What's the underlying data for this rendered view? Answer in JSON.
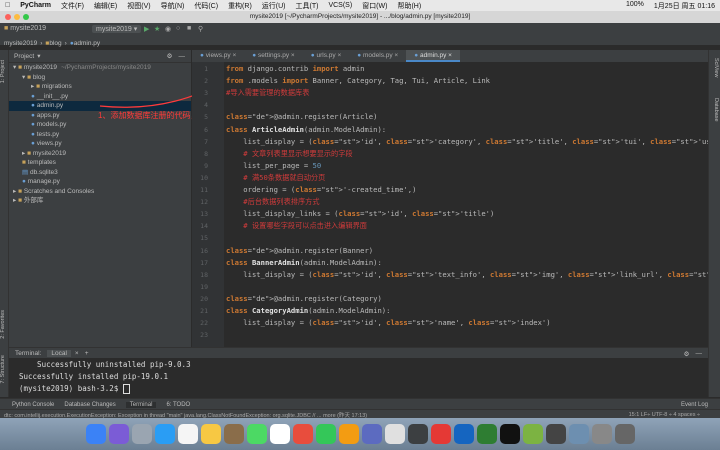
{
  "menubar": {
    "app": "PyCharm",
    "items": [
      "文件(F)",
      "编辑(E)",
      "视图(V)",
      "导航(N)",
      "代码(C)",
      "重构(R)",
      "运行(U)",
      "工具(T)",
      "VCS(S)",
      "窗口(W)",
      "帮助(H)"
    ],
    "battery": "100%",
    "clock": "1月25日 周五 01:16"
  },
  "titlebar": {
    "title": "mysite2019 [~/PycharmProjects/mysite2019] - .../blog/admin.py [mysite2019]"
  },
  "navbar": {
    "project": "mysite2019",
    "run_config": "mysite2019"
  },
  "breadcrumbs": [
    "mysite2019",
    "blog",
    "admin.py"
  ],
  "project_panel": {
    "title": "Project",
    "tree": [
      {
        "label": "mysite2019",
        "extra": "~/PycharmProjects/mysite2019",
        "type": "folder"
      },
      {
        "label": "blog",
        "type": "folder"
      },
      {
        "label": "migrations",
        "type": "folder"
      },
      {
        "label": "__init__.py",
        "type": "py"
      },
      {
        "label": "admin.py",
        "type": "py"
      },
      {
        "label": "apps.py",
        "type": "py"
      },
      {
        "label": "models.py",
        "type": "py"
      },
      {
        "label": "tests.py",
        "type": "py"
      },
      {
        "label": "views.py",
        "type": "py"
      },
      {
        "label": "mysite2019",
        "type": "folder"
      },
      {
        "label": "templates",
        "type": "folder"
      },
      {
        "label": "db.sqlite3",
        "type": "file"
      },
      {
        "label": "manage.py",
        "type": "py"
      },
      {
        "label": "Scratches and Consoles",
        "type": "folder"
      },
      {
        "label": "外部库",
        "type": "folder"
      }
    ]
  },
  "annotation": "1、添加数据库注册的代码，保存",
  "tabs": [
    "views.py",
    "settings.py",
    "urls.py",
    "models.py",
    "admin.py"
  ],
  "active_tab": "admin.py",
  "code_lines": [
    "from django.contrib import admin",
    "from .models import Banner, Category, Tag, Tui, Article, Link",
    "#导入需要管理的数据库表",
    "",
    "@admin.register(Article)",
    "class ArticleAdmin(admin.ModelAdmin):",
    "    list_display = ('id', 'category', 'title', 'tui', 'user', 'views', 'created_time')",
    "    # 文章列表里显示想要显示的字段",
    "    list_per_page = 50",
    "    # 满50条数据就自动分页",
    "    ordering = ('-created_time',)",
    "    #后台数据列表排序方式",
    "    list_display_links = ('id', 'title')",
    "    # 设置哪些字段可以点击进入编辑界面",
    "",
    "@admin.register(Banner)",
    "class BannerAdmin(admin.ModelAdmin):",
    "    list_display = ('id', 'text_info', 'img', 'link_url', 'is_active')",
    "",
    "@admin.register(Category)",
    "class CategoryAdmin(admin.ModelAdmin):",
    "    list_display = ('id', 'name', 'index')",
    ""
  ],
  "terminal": {
    "label": "Terminal:",
    "tab": "Local",
    "lines": [
      "    Successfully uninstalled pip-9.0.3",
      "Successfully installed pip-19.0.1",
      "(mysite2019) bash-3.2$ "
    ]
  },
  "toolwindows": [
    "Python Console",
    "Database Changes",
    "Terminal",
    "6: TODO",
    "Event Log"
  ],
  "statusbar": {
    "message": "dtc: com.intellij.execution.ExecutionException: Exception in thread \"main\" java.lang.ClassNotFoundException: org.sqlite.JDBC // ... more (昨天 17:13)",
    "position": "15:1  LF÷  UTF-8 ÷  4 spaces ÷"
  },
  "left_strip": [
    "1: Project",
    "2: Favorites",
    "7: Structure"
  ],
  "right_strip": [
    "SciView",
    "Database"
  ],
  "dock_colors": [
    "#3b82f6",
    "#7b5cd6",
    "#9aa5b1",
    "#2a9df4",
    "#f5f5f5",
    "#f7c843",
    "#8a6d4a",
    "#4cd964",
    "#ffffff",
    "#e84d3d",
    "#34c759",
    "#f39c12",
    "#5c6bc0",
    "#e0e0e0",
    "#3c3f41",
    "#e53935",
    "#1565c0",
    "#2e7d32",
    "#111111",
    "#7cb342",
    "#444444",
    "#6d8fb0",
    "#888888",
    "#666666"
  ]
}
